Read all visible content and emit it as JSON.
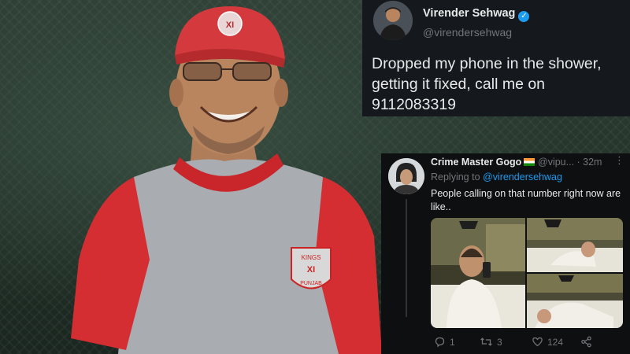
{
  "tweet_main": {
    "display_name": "Virender Sehwag",
    "handle": "@virendersehwag",
    "text": "Dropped my phone in the shower, getting it fixed, call me on 9112083319"
  },
  "tweet_reply": {
    "display_name": "Crime Master Gogo",
    "handle_time": "@vipu... · 32m",
    "replying_prefix": "Replying to ",
    "replying_handle": "@virendersehwag",
    "text": "People calling on that number right now are like..",
    "actions": {
      "reply_count": "1",
      "retweet_count": "3",
      "like_count": "124"
    }
  },
  "photo_cap_logo": "XI",
  "photo_shirt_badge": [
    "KINGS",
    "XI",
    "PUNJAB"
  ],
  "colors": {
    "twitter_blue": "#1d9bf0",
    "tweet_bg": "#15181c",
    "muted_text": "#71767b",
    "jersey_red": "#d42e33"
  },
  "icons": [
    "verified-badge-icon",
    "india-flag-icon",
    "more-options-icon",
    "reply-icon",
    "retweet-icon",
    "like-icon",
    "share-icon"
  ]
}
